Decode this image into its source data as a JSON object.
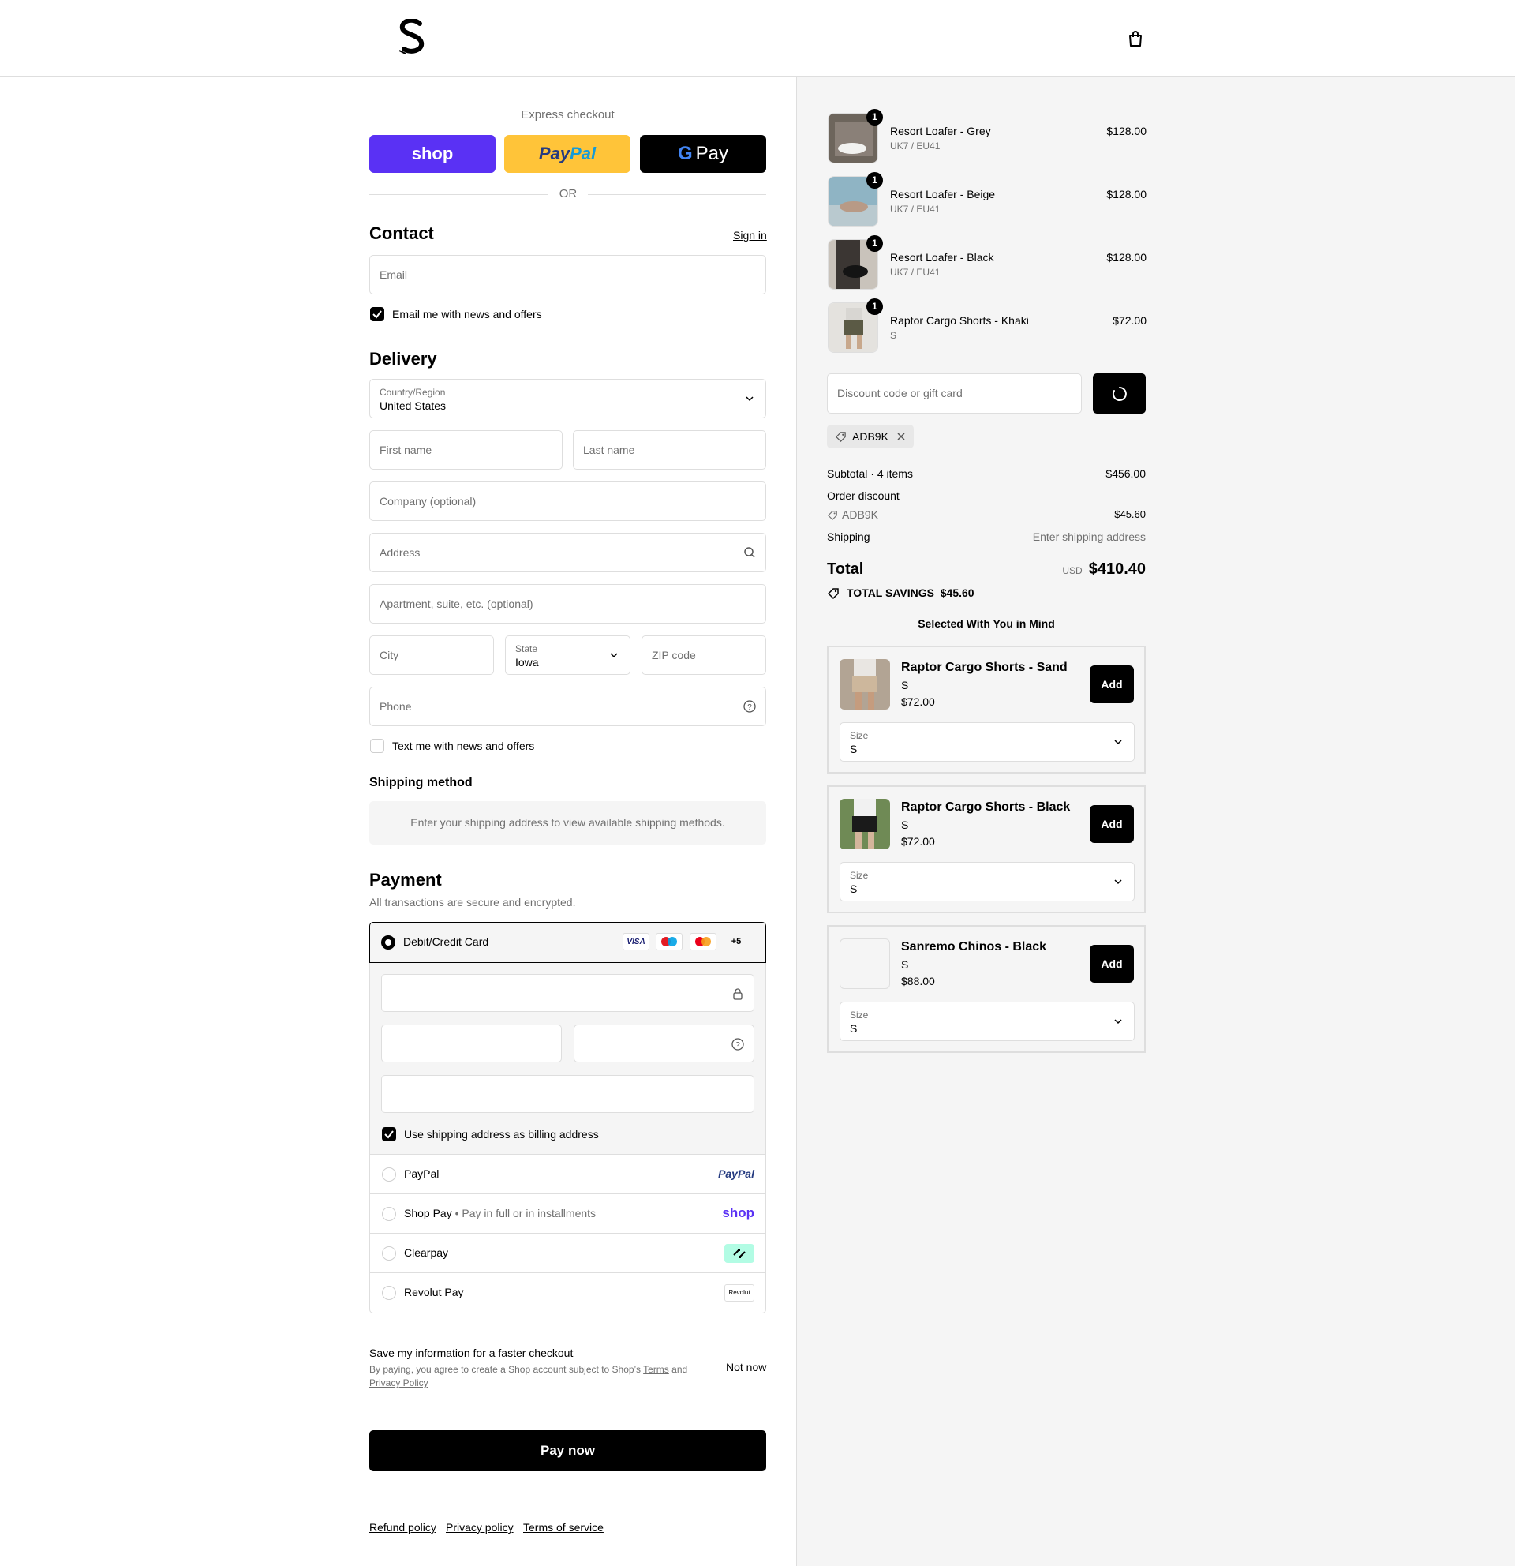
{
  "header": {
    "logo_name": "store-logo",
    "cart_icon": "shopping-bag-icon"
  },
  "express": {
    "label": "Express checkout",
    "shop": "shop",
    "paypal_a": "Pay",
    "paypal_b": "Pal",
    "gpay": "Pay",
    "or": "OR"
  },
  "contact": {
    "title": "Contact",
    "sign_in": "Sign in",
    "email_placeholder": "Email",
    "news_label": "Email me with news and offers"
  },
  "delivery": {
    "title": "Delivery",
    "country_label": "Country/Region",
    "country_value": "United States",
    "first_name": "First name",
    "last_name": "Last name",
    "company": "Company (optional)",
    "address": "Address",
    "apartment": "Apartment, suite, etc. (optional)",
    "city": "City",
    "state_label": "State",
    "state_value": "Iowa",
    "zip": "ZIP code",
    "phone": "Phone",
    "text_label": "Text me with news and offers"
  },
  "shipping": {
    "title": "Shipping method",
    "note": "Enter your shipping address to view available shipping methods."
  },
  "payment": {
    "title": "Payment",
    "subtitle": "All transactions are secure and encrypted.",
    "card_label": "Debit/Credit Card",
    "badges": [
      "VISA",
      "+5"
    ],
    "billing_label": "Use shipping address as billing address",
    "methods": [
      {
        "name": "PayPal",
        "extra": "",
        "logo": "PayPal"
      },
      {
        "name": "Shop Pay",
        "extra": "Pay in full or in installments",
        "logo": "shop"
      },
      {
        "name": "Clearpay",
        "extra": "",
        "logo": "clearpay-icon"
      },
      {
        "name": "Revolut Pay",
        "extra": "",
        "logo": "Revolut"
      }
    ]
  },
  "save_info": {
    "title": "Save my information for a faster checkout",
    "text_a": "By paying, you agree to create a Shop account subject to Shop’s",
    "terms": "Terms",
    "text_b": "and",
    "privacy": "Privacy Policy",
    "not_now": "Not now"
  },
  "pay_now": "Pay now",
  "footer": {
    "refund": "Refund policy",
    "privacy": "Privacy policy",
    "terms": "Terms of service"
  },
  "cart": {
    "items": [
      {
        "name": "Resort Loafer - Grey",
        "variant": "UK7 / EU41",
        "price": "$128.00",
        "qty": "1"
      },
      {
        "name": "Resort Loafer - Beige",
        "variant": "UK7 / EU41",
        "price": "$128.00",
        "qty": "1"
      },
      {
        "name": "Resort Loafer - Black",
        "variant": "UK7 / EU41",
        "price": "$128.00",
        "qty": "1"
      },
      {
        "name": "Raptor Cargo Shorts - Khaki",
        "variant": "S",
        "price": "$72.00",
        "qty": "1"
      }
    ],
    "discount_placeholder": "Discount code or gift card",
    "applied_code": "ADB9K",
    "subtotal_label": "Subtotal · 4 items",
    "subtotal_value": "$456.00",
    "order_discount": "Order discount",
    "discount_code": "ADB9K",
    "discount_value": "– $45.60",
    "shipping_label": "Shipping",
    "shipping_value": "Enter shipping address",
    "total_label": "Total",
    "currency": "USD",
    "total_value": "$410.40",
    "savings_label": "TOTAL SAVINGS",
    "savings_value": "$45.60"
  },
  "recommend": {
    "title": "Selected With You in Mind",
    "items": [
      {
        "name": "Raptor Cargo Shorts - Sand",
        "variant": "S",
        "price": "$72.00",
        "add": "Add",
        "size_label": "Size",
        "size_value": "S"
      },
      {
        "name": "Raptor Cargo Shorts - Black",
        "variant": "S",
        "price": "$72.00",
        "add": "Add",
        "size_label": "Size",
        "size_value": "S"
      },
      {
        "name": "Sanremo Chinos - Black",
        "variant": "S",
        "price": "$88.00",
        "add": "Add",
        "size_label": "Size",
        "size_value": "S"
      }
    ]
  },
  "colors": {
    "shop": "#5a31f4",
    "paypal": "#ffc439",
    "accent": "#000000",
    "panel": "#f5f5f5",
    "border": "#dedede"
  }
}
